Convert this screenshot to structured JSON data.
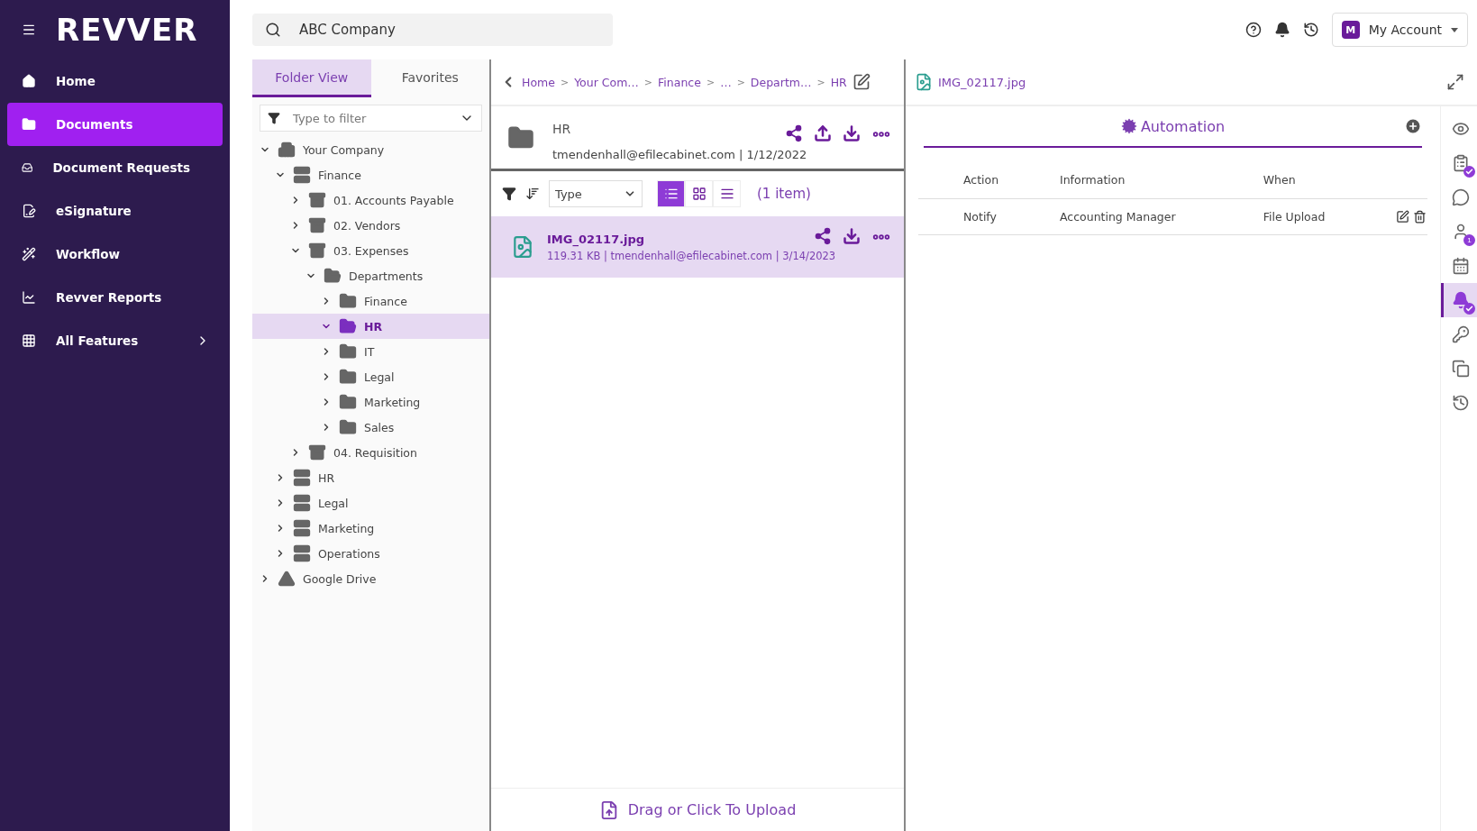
{
  "sidebar": {
    "logo": "REVVER",
    "items": [
      {
        "kind": "home",
        "label": "Home",
        "selected": false,
        "submenu": false
      },
      {
        "kind": "documents",
        "label": "Documents",
        "selected": true,
        "submenu": false
      },
      {
        "kind": "requests",
        "label": "Document Requests",
        "selected": false,
        "submenu": false
      },
      {
        "kind": "signature",
        "label": "eSignature",
        "selected": false,
        "submenu": false
      },
      {
        "kind": "workflow",
        "label": "Workflow",
        "selected": false,
        "submenu": false
      },
      {
        "kind": "reports",
        "label": "Revver Reports",
        "selected": false,
        "submenu": false
      },
      {
        "kind": "features",
        "label": "All Features",
        "selected": false,
        "submenu": true
      }
    ]
  },
  "search": {
    "value": "ABC Company"
  },
  "account": {
    "initial": "M",
    "label": "My Account"
  },
  "tree_panel": {
    "tabs": [
      {
        "label": "Folder View",
        "selected": true
      },
      {
        "label": "Favorites",
        "selected": false
      }
    ],
    "filter": {
      "placeholder": "Type to filter"
    },
    "tree": [
      {
        "kind": "company",
        "label": "Your Company",
        "expanded": true,
        "selected": false,
        "children": [
          {
            "kind": "cabinet",
            "label": "Finance",
            "expanded": true,
            "selected": false,
            "children": [
              {
                "kind": "drawer",
                "label": "01. Accounts Payable",
                "expanded": false,
                "selected": false
              },
              {
                "kind": "drawer",
                "label": "02. Vendors",
                "expanded": false,
                "selected": false
              },
              {
                "kind": "drawer",
                "label": "03. Expenses",
                "expanded": true,
                "selected": false,
                "children": [
                  {
                    "kind": "folder",
                    "label": "Departments",
                    "expanded": true,
                    "selected": false,
                    "children": [
                      {
                        "kind": "folder",
                        "label": "Finance",
                        "expanded": false,
                        "selected": false
                      },
                      {
                        "kind": "folder",
                        "label": "HR",
                        "expanded": true,
                        "selected": true
                      },
                      {
                        "kind": "folder",
                        "label": "IT",
                        "expanded": false,
                        "selected": false
                      },
                      {
                        "kind": "folder",
                        "label": "Legal",
                        "expanded": false,
                        "selected": false
                      },
                      {
                        "kind": "folder",
                        "label": "Marketing",
                        "expanded": false,
                        "selected": false
                      },
                      {
                        "kind": "folder",
                        "label": "Sales",
                        "expanded": false,
                        "selected": false
                      }
                    ]
                  }
                ]
              },
              {
                "kind": "drawer",
                "label": "04. Requisition",
                "expanded": false,
                "selected": false
              }
            ]
          },
          {
            "kind": "cabinet",
            "label": "HR",
            "expanded": false,
            "selected": false
          },
          {
            "kind": "cabinet",
            "label": "Legal",
            "expanded": false,
            "selected": false
          },
          {
            "kind": "cabinet",
            "label": "Marketing",
            "expanded": false,
            "selected": false
          },
          {
            "kind": "cabinet",
            "label": "Operations",
            "expanded": false,
            "selected": false
          }
        ]
      },
      {
        "kind": "drive",
        "label": "Google Drive",
        "expanded": false,
        "selected": false
      }
    ]
  },
  "folder_panel": {
    "breadcrumb": {
      "separator": ">",
      "items": [
        "Home",
        "Your Com…",
        "Finance",
        "…",
        "Departm…",
        "HR"
      ]
    },
    "folder": {
      "name": "HR",
      "details": "tmendenhall@efilecabinet.com | 1/12/2022"
    },
    "sort": {
      "value": "Type"
    },
    "views": [
      {
        "kind": "list",
        "selected": true
      },
      {
        "kind": "grid",
        "selected": false
      },
      {
        "kind": "details",
        "selected": false
      }
    ],
    "count": "(1 item)",
    "files": [
      {
        "name": "IMG_02117.jpg",
        "details": "119.31 KB | tmendenhall@efilecabinet.com | 3/14/2023",
        "selected": true
      }
    ],
    "upload": "Drag or Click To Upload"
  },
  "detail_panel": {
    "file": "IMG_02117.jpg",
    "section": "Automation",
    "columns": [
      "Action",
      "Information",
      "When"
    ],
    "rows": [
      [
        "Notify",
        "Accounting Manager",
        "File Upload"
      ]
    ],
    "rail": [
      {
        "kind": "preview",
        "selected": false
      },
      {
        "kind": "tasks",
        "selected": false,
        "checked": true
      },
      {
        "kind": "comments",
        "selected": false
      },
      {
        "kind": "users",
        "selected": false,
        "count": "1"
      },
      {
        "kind": "retention",
        "selected": false
      },
      {
        "kind": "automation",
        "selected": true,
        "checked": true
      },
      {
        "kind": "permissions",
        "selected": false
      },
      {
        "kind": "versions",
        "selected": false
      },
      {
        "kind": "history",
        "selected": false
      }
    ]
  }
}
